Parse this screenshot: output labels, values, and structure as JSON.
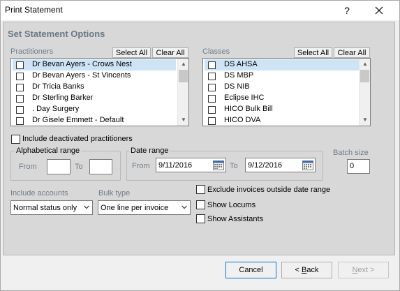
{
  "window": {
    "title": "Print Statement",
    "help_label": "?"
  },
  "heading": "Set Statement Options",
  "practitioners": {
    "label": "Practitioners",
    "select_all": "Select All",
    "clear_all": "Clear All",
    "items": [
      {
        "label": "Dr Bevan Ayers - Crows Nest",
        "selected": true
      },
      {
        "label": "Dr Bevan Ayers - St Vincents",
        "selected": false
      },
      {
        "label": "Dr Tricia Banks",
        "selected": false
      },
      {
        "label": "Dr Sterling Barker",
        "selected": false
      },
      {
        "label": ". Day Surgery",
        "selected": false
      },
      {
        "label": "Dr Gisele Emmett - Default",
        "selected": false
      }
    ]
  },
  "classes": {
    "label": "Classes",
    "select_all": "Select All",
    "clear_all": "Clear All",
    "items": [
      {
        "label": "DS AHSA",
        "selected": true
      },
      {
        "label": "DS MBP",
        "selected": false
      },
      {
        "label": "DS NIB",
        "selected": false
      },
      {
        "label": "Eclipse IHC",
        "selected": false
      },
      {
        "label": "HICO Bulk Bill",
        "selected": false
      },
      {
        "label": "HICO DVA",
        "selected": false
      }
    ]
  },
  "include_deactivated": {
    "label": "Include deactivated practitioners",
    "checked": false
  },
  "alpha_range": {
    "title": "Alphabetical range",
    "from_label": "From",
    "from_value": "",
    "to_label": "To",
    "to_value": ""
  },
  "date_range": {
    "title": "Date range",
    "from_label": "From",
    "from_value": "9/11/2016",
    "to_label": "To",
    "to_value": "9/12/2016"
  },
  "batch_size": {
    "label": "Batch size",
    "value": "0"
  },
  "include_accounts": {
    "label": "Include accounts",
    "value": "Normal status only"
  },
  "bulk_type": {
    "label": "Bulk type",
    "value": "One line per invoice"
  },
  "options": {
    "exclude_invoices": {
      "label": "Exclude invoices outside date range",
      "checked": false
    },
    "show_locums": {
      "label": "Show Locums",
      "checked": false
    },
    "show_assistants": {
      "label": "Show Assistants",
      "checked": false
    }
  },
  "footer": {
    "cancel": "Cancel",
    "back_prefix": "< ",
    "back_mnemonic": "B",
    "back_rest": "ack",
    "next_mnemonic": "N",
    "next_rest": "ext >"
  },
  "colors": {
    "heading": "#6b7787",
    "label": "#6f7c8c",
    "selection": "#cde4f7",
    "primary_border": "#0078d7"
  }
}
